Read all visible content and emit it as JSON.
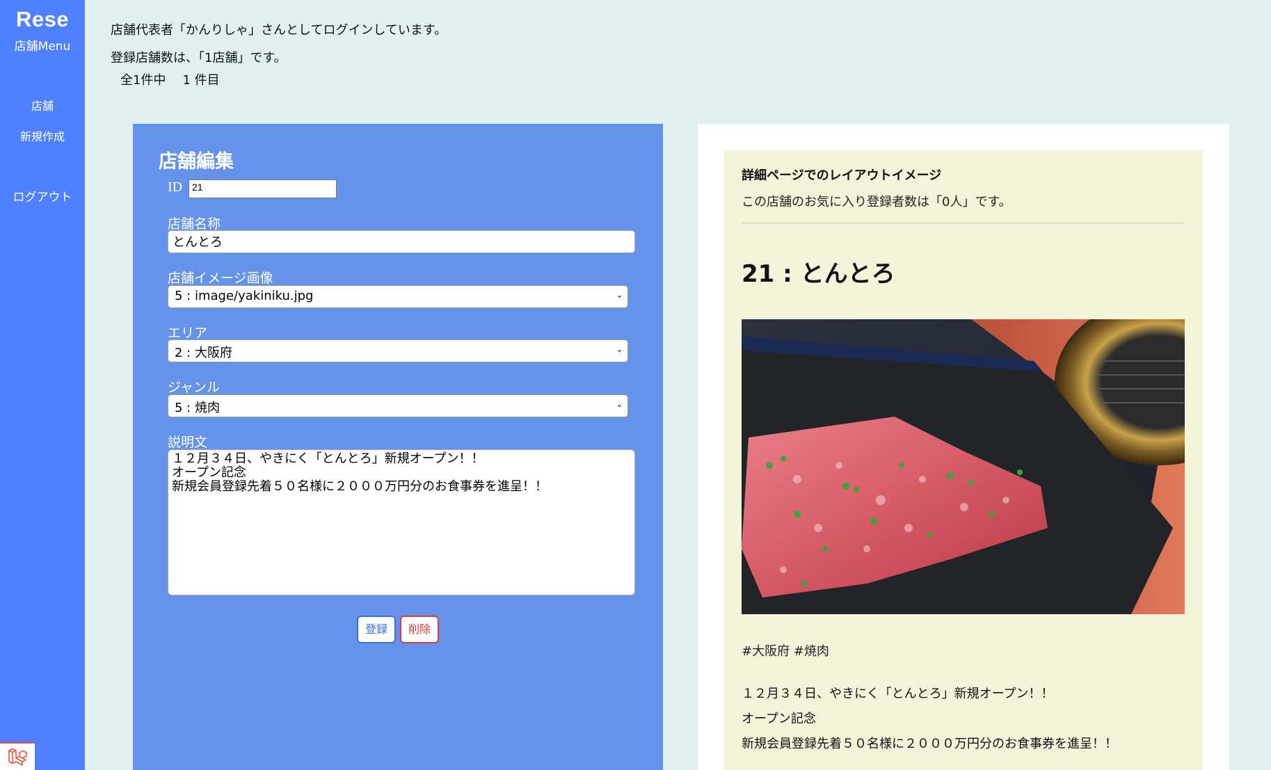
{
  "sidebar": {
    "brand": "Rese",
    "menu_title": "店舗Menu",
    "items": [
      {
        "label": "店舗"
      },
      {
        "label": "新規作成"
      },
      {
        "label": "ログアウト"
      }
    ]
  },
  "info": {
    "login_message": "店舗代表者「かんりしゃ」さんとしてログインしています。",
    "store_count_message": "登録店舗数は、「1店舗」です。",
    "total_text": "全1件中",
    "current_text": "1 件目"
  },
  "edit_form": {
    "title": "店舗編集",
    "id_label": "ID",
    "id_value": "21",
    "name_label": "店舗名称",
    "name_value": "とんとろ",
    "image_label": "店舗イメージ画像",
    "image_selected": "5 : image/yakiniku.jpg",
    "area_label": "エリア",
    "area_selected": "2 : 大阪府",
    "genre_label": "ジャンル",
    "genre_selected": "5 : 焼肉",
    "description_label": "説明文",
    "description_value": "１２月３４日、やきにく「とんとろ」新規オープン！！\nオープン記念\n新規会員登録先着５０名様に２０００万円分のお食事券を進呈！！",
    "save_label": "登録",
    "delete_label": "削除"
  },
  "preview": {
    "heading": "詳細ページでのレイアウトイメージ",
    "favorite_text": "この店舗のお気に入り登録者数は「0人」です。",
    "shop_title": "21 : とんとろ",
    "tags": "#大阪府 #焼肉",
    "description_lines": [
      "１２月３４日、やきにく「とんとろ」新規オープン！！",
      "オープン記念",
      "新規会員登録先着５０名様に２０００万円分のお食事券を進呈！！"
    ]
  },
  "colors": {
    "sidebar_bg": "#4f80ff",
    "page_bg": "#e1efef",
    "edit_panel_bg": "#6593ea",
    "preview_card_bg": "#f3f3da",
    "save_accent": "#3a6cf0",
    "delete_accent": "#e53b3b"
  },
  "icons": {
    "select_chevron": "chevron-down-icon",
    "laravel": "laravel-logo-icon"
  }
}
